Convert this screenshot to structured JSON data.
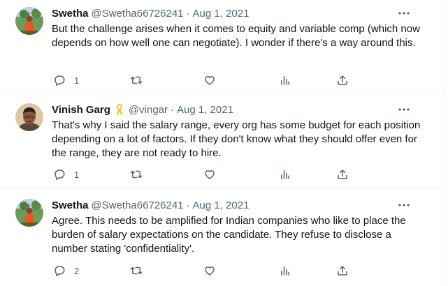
{
  "colors": {
    "text": "#0f1419",
    "secondary": "#536471",
    "divider": "#eff3f4",
    "ribbon": "#f2c230"
  },
  "tweets": [
    {
      "name": "Swetha",
      "handle": "@Swetha66726241",
      "sep": "·",
      "date": "Aug 1, 2021",
      "badge": null,
      "text": "But the challenge arises when it comes to equity and variable comp (which now depends on how well one can negotiate). I wonder if there's a way around this.",
      "reply_count": "1",
      "retweet_count": "",
      "like_count": "",
      "icons": [
        "reply-icon",
        "retweet-icon",
        "like-icon",
        "views-icon",
        "share-icon",
        "more-icon"
      ]
    },
    {
      "name": "Vinish Garg",
      "handle": "@vingar",
      "sep": "·",
      "date": "Aug 1, 2021",
      "badge": "ribbon-icon",
      "text": "That's why I said the salary range, every org has some budget for each position depending on a lot of factors. If they don't know what they should offer even for the range, they are not ready to hire.",
      "reply_count": "1",
      "retweet_count": "",
      "like_count": "",
      "icons": [
        "reply-icon",
        "retweet-icon",
        "like-icon",
        "views-icon",
        "share-icon",
        "more-icon"
      ]
    },
    {
      "name": "Swetha",
      "handle": "@Swetha66726241",
      "sep": "·",
      "date": "Aug 1, 2021",
      "badge": null,
      "text": "Agree. This needs to be amplified for Indian companies who like to place the burden of salary expectations on the candidate. They refuse to disclose a number stating 'confidentiality'.",
      "reply_count": "2",
      "retweet_count": "",
      "like_count": "",
      "icons": [
        "reply-icon",
        "retweet-icon",
        "like-icon",
        "views-icon",
        "share-icon",
        "more-icon"
      ]
    }
  ]
}
